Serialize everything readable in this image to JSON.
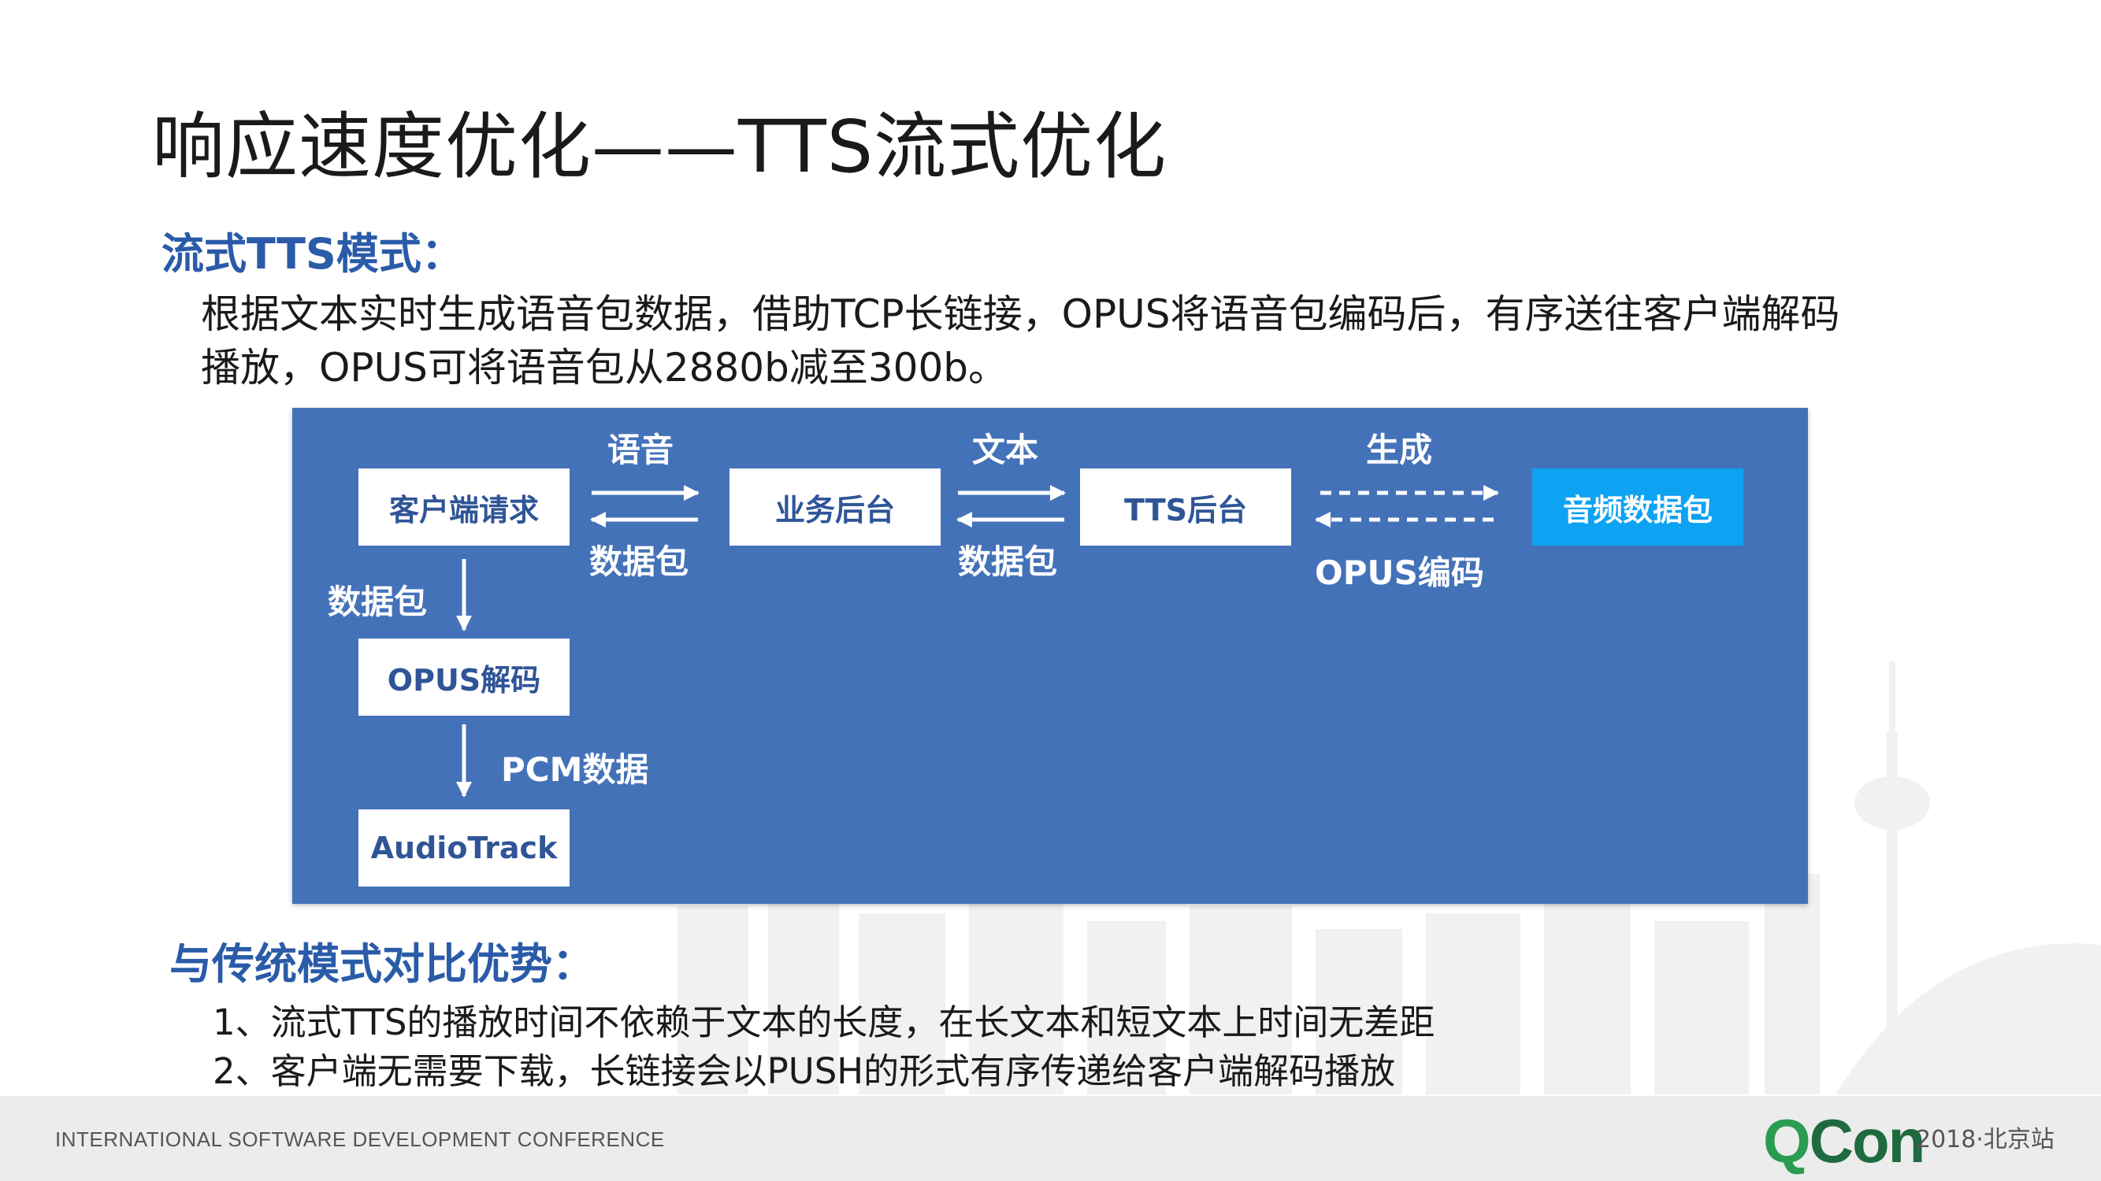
{
  "slide": {
    "title": "响应速度优化——TTS流式优化",
    "section1": {
      "heading": "流式TTS模式：",
      "lines": [
        "根据文本实时生成语音包数据，借助TCP长链接，OPUS将语音包编码后，有序送往客户端解码",
        "播放，OPUS可将语音包从2880b减至300b。"
      ]
    },
    "section2": {
      "heading": "与传统模式对比优势：",
      "items": [
        "1、流式TTS的播放时间不依赖于文本的长度，在长文本和短文本上时间无差距",
        "2、客户端无需要下载，长链接会以PUSH的形式有序传递给客户端解码播放"
      ]
    }
  },
  "diagram": {
    "colors": {
      "background": "#4472b9",
      "node": "#ffffff",
      "node_text": "#2f5597",
      "accent": "#0ea2f2"
    },
    "nodes": {
      "client_request": "客户端请求",
      "business_backend": "业务后台",
      "tts_backend": "TTS后台",
      "audio_packet": "音频数据包",
      "opus_decode": "OPUS解码",
      "audiotrack": "AudioTrack"
    },
    "labels": {
      "voice": "语音",
      "packet_1": "数据包",
      "text": "文本",
      "packet_2": "数据包",
      "generate": "生成",
      "opus_encode": "OPUS编码",
      "packet_down": "数据包",
      "pcm": "PCM数据"
    }
  },
  "footer": {
    "conference": "INTERNATIONAL SOFTWARE DEVELOPMENT CONFERENCE",
    "brand_q": "Q",
    "brand_rest": "Con",
    "edition": "2018·北京站"
  }
}
